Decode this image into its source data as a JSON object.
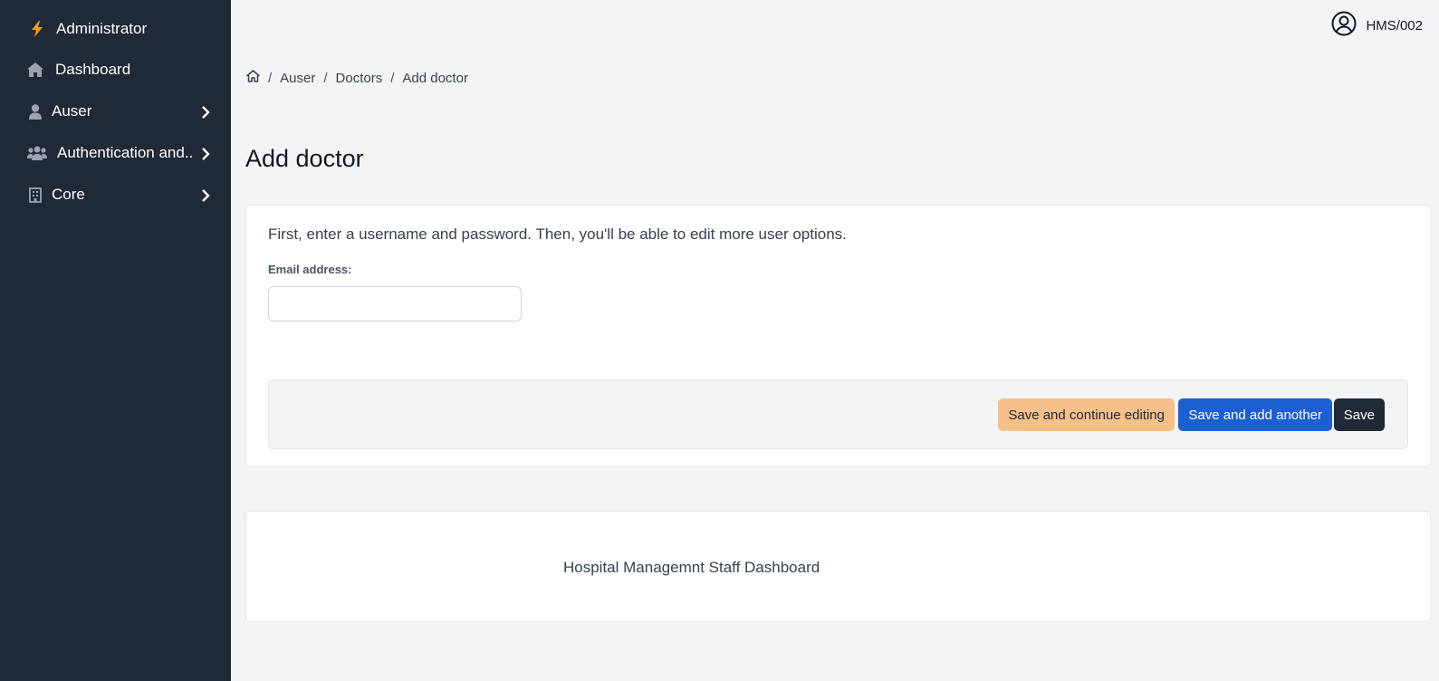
{
  "sidebar": {
    "brand": {
      "label": "Administrator",
      "icon": "bolt-icon",
      "accent": "#f59e0b"
    },
    "items": [
      {
        "label": "Dashboard",
        "icon": "home-icon",
        "has_children": false
      },
      {
        "label": "Auser",
        "icon": "user-icon",
        "has_children": true
      },
      {
        "label": "Authentication and..",
        "icon": "users-icon",
        "has_children": true
      },
      {
        "label": "Core",
        "icon": "building-icon",
        "has_children": true
      }
    ]
  },
  "topbar": {
    "username": "HMS/002",
    "icon": "user-circle-icon"
  },
  "breadcrumb": {
    "home_icon": "home-icon",
    "items": [
      "Auser",
      "Doctors",
      "Add doctor"
    ],
    "separator": "/"
  },
  "page": {
    "title": "Add doctor"
  },
  "form": {
    "intro": "First, enter a username and password. Then, you'll be able to edit more user options.",
    "email_label": "Email address:",
    "email_value": "",
    "buttons": {
      "continue": "Save and continue editing",
      "add_another": "Save and add another",
      "save": "Save"
    }
  },
  "footer": {
    "text": "Hospital Managemnt Staff Dashboard"
  },
  "colors": {
    "sidebar_bg": "#1f2937",
    "continue_btn": "#f5c08a",
    "add_another_btn": "#1d5fd1",
    "save_btn": "#1f2937"
  }
}
